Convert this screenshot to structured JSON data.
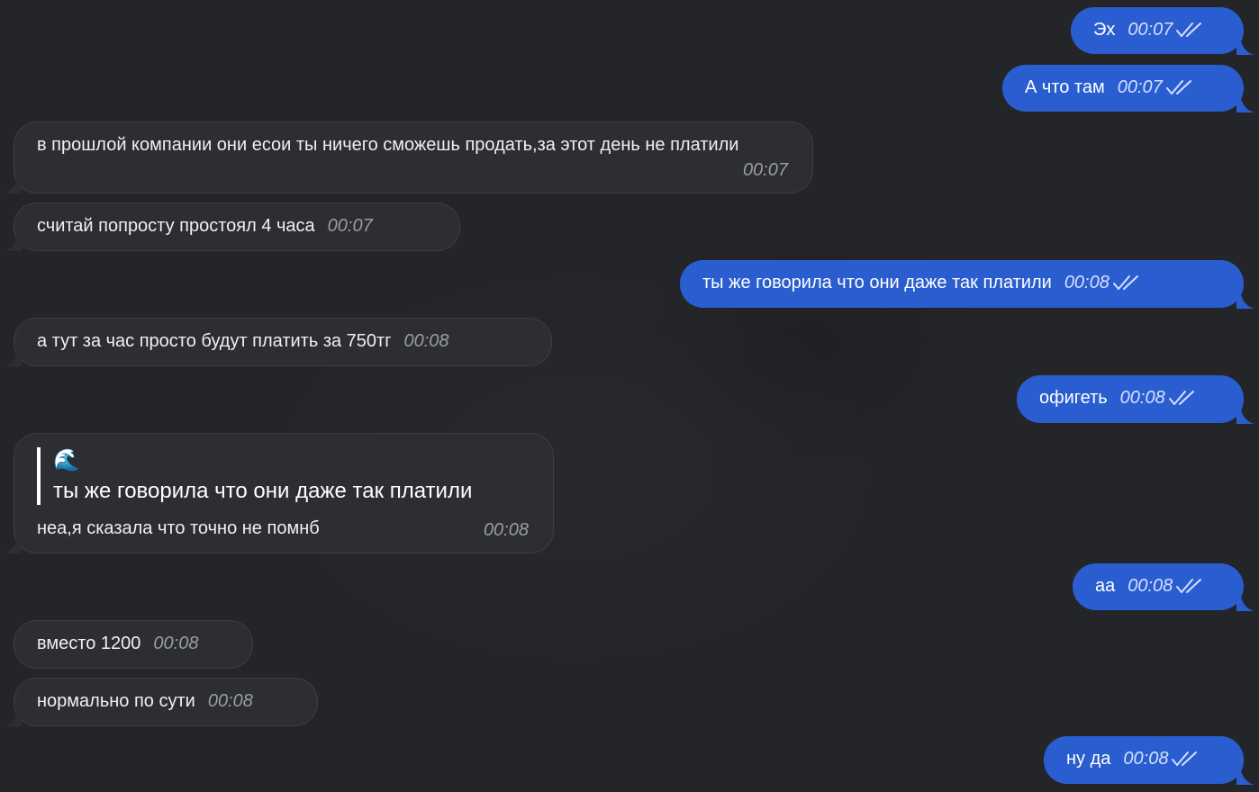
{
  "chat": {
    "messages": [
      {
        "dir": "out",
        "text": "Эх",
        "time": "00:07",
        "checks": "double-check-icon"
      },
      {
        "dir": "out",
        "text": "А что там",
        "time": "00:07",
        "checks": "double-check-icon"
      },
      {
        "dir": "in",
        "text": "в прошлой компании они есои ты ничего сможешь продать,за этот день не платили",
        "time": "00:07"
      },
      {
        "dir": "in",
        "text": "считай попросту простоял 4 часа",
        "time": "00:07"
      },
      {
        "dir": "out",
        "text": "ты же говорила что они даже так платили",
        "time": "00:08",
        "checks": "double-check-icon"
      },
      {
        "dir": "in",
        "text": "а тут за час просто будут платить за 750тг",
        "time": "00:08"
      },
      {
        "dir": "out",
        "text": "офигеть",
        "time": "00:08",
        "checks": "double-check-icon"
      },
      {
        "dir": "in",
        "reply": {
          "emoji": "🌊",
          "quoted_text": "ты же говорила что они даже так платили"
        },
        "text": "неа,я сказала что точно не помнб",
        "time": "00:08"
      },
      {
        "dir": "out",
        "text": "аа",
        "time": "00:08",
        "checks": "double-check-icon"
      },
      {
        "dir": "in",
        "text": "вместо 1200",
        "time": "00:08"
      },
      {
        "dir": "in",
        "text": "нормально по сути",
        "time": "00:08"
      },
      {
        "dir": "out",
        "text": "ну да",
        "time": "00:08",
        "checks": "double-check-icon"
      }
    ]
  },
  "colors": {
    "background": "#232528",
    "incoming_bubble": "#2d2e31",
    "outgoing_bubble": "#2a5ed0"
  }
}
